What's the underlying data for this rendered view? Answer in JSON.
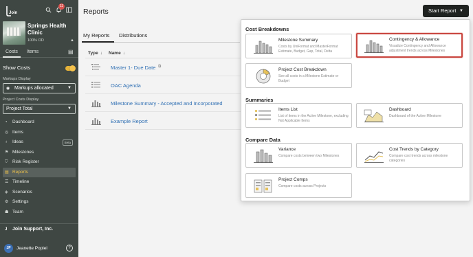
{
  "sidebar": {
    "logo_text": "Join",
    "notification_count": "11",
    "project": {
      "name": "Springs Health Clinic",
      "sub": "100% OD"
    },
    "tabs": {
      "costs": "Costs",
      "items": "Items"
    },
    "show_costs_label": "Show Costs",
    "markups_display_label": "Markups Display",
    "markups_value": "Markups allocated",
    "project_costs_label": "Project Costs Display",
    "project_costs_value": "Project Total",
    "nav": [
      {
        "label": "Dashboard",
        "icon": "dashboard-icon"
      },
      {
        "label": "Items",
        "icon": "items-icon"
      },
      {
        "label": "Ideas",
        "icon": "lightbulb-icon",
        "badge": "Beta"
      },
      {
        "label": "Milestones",
        "icon": "flag-icon"
      },
      {
        "label": "Risk Register",
        "icon": "shield-icon"
      },
      {
        "label": "Reports",
        "icon": "report-icon",
        "active": true
      },
      {
        "label": "Timeline",
        "icon": "timeline-icon"
      },
      {
        "label": "Scenarios",
        "icon": "scenarios-icon"
      },
      {
        "label": "Settings",
        "icon": "settings-icon"
      },
      {
        "label": "Team",
        "icon": "team-icon"
      }
    ],
    "org_name": "Join Support, Inc.",
    "user": {
      "initials": "JP",
      "name": "Jeanette Popiel"
    }
  },
  "main": {
    "title": "Reports",
    "start_report": "Start Report",
    "subtabs": {
      "my_reports": "My Reports",
      "distributions": "Distributions"
    },
    "table": {
      "col_type": "Type",
      "col_name": "Name",
      "rows": [
        {
          "name": "Master 1- Due Date",
          "icon": "breakdown-list-icon"
        },
        {
          "name": "OAC Agenda",
          "icon": "agenda-list-icon"
        },
        {
          "name": "Milestone Summary - Accepted and Incorporated",
          "icon": "bar-chart-icon"
        },
        {
          "name": "Example Report",
          "icon": "bar-chart-icon"
        }
      ]
    }
  },
  "dropdown": {
    "sections": {
      "cost_breakdowns": "Cost Breakdowns",
      "summaries": "Summaries",
      "compare_data": "Compare Data"
    },
    "cards": {
      "milestone_summary": {
        "title": "Milestone Summary",
        "desc": "Costs by UniFormat and MasterFormat Estimate, Budget, Gap, Total, Delta"
      },
      "contingency": {
        "title": "Contingency & Allowance",
        "desc": "Visualize Contingency and Allowance adjustment trends across Milestones"
      },
      "project_breakdown": {
        "title": "Project Cost Breakdown",
        "desc": "See all costs in a Milestone Estimate or Budget"
      },
      "items_list": {
        "title": "Items List",
        "desc": "List of items in the Active Milestone, excluding Not Applicable Items"
      },
      "dashboard": {
        "title": "Dashboard",
        "desc": "Dashboard of the Active Milestone"
      },
      "variance": {
        "title": "Variance",
        "desc": "Compare costs between two Milestones"
      },
      "cost_trends": {
        "title": "Cost Trends by Category",
        "desc": "Compare cost trends across milestone categories"
      },
      "project_comps": {
        "title": "Project Comps",
        "desc": "Compare costs across Projects"
      }
    }
  },
  "colors": {
    "sidebar_bg": "#3f4743",
    "accent_yellow": "#f1c44a",
    "link_blue": "#2f6fb3",
    "selection_red": "#c9463f"
  }
}
